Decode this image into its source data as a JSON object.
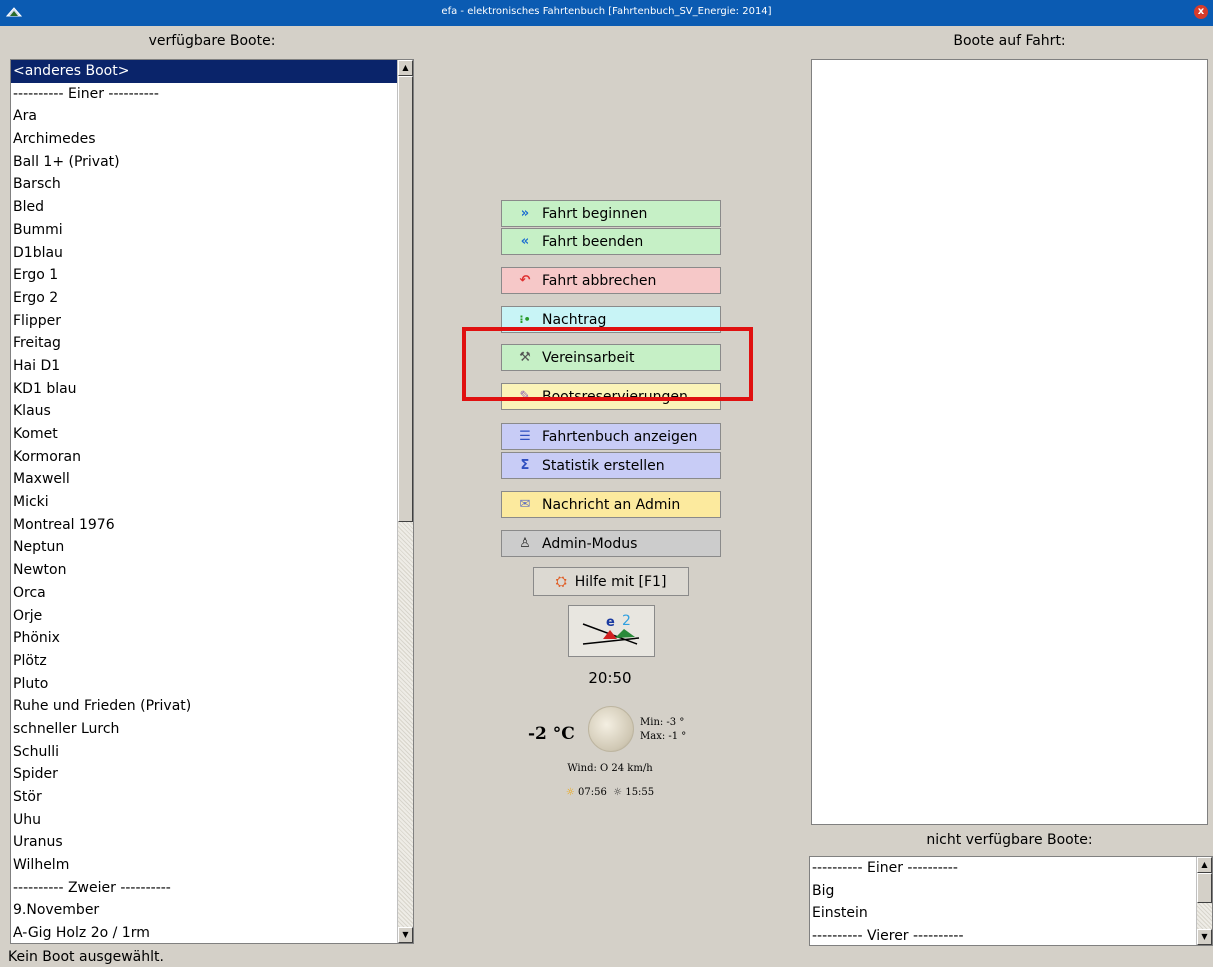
{
  "window": {
    "title": "efa - elektronisches Fahrtenbuch [Fahrtenbuch_SV_Energie: 2014]",
    "close_glyph": "x"
  },
  "available_boats": {
    "title": "verfügbare Boote:",
    "items": [
      "<anderes Boot>",
      "---------- Einer ----------",
      "Ara",
      "Archimedes",
      "Ball 1+ (Privat)",
      "Barsch",
      "Bled",
      "Bummi",
      "D1blau",
      "Ergo 1",
      "Ergo 2",
      "Flipper",
      "Freitag",
      "Hai D1",
      "KD1 blau",
      "Klaus",
      "Komet",
      "Kormoran",
      "Maxwell",
      "Micki",
      "Montreal 1976",
      "Neptun",
      "Newton",
      "Orca",
      "Orje",
      "Phönix",
      "Plötz",
      "Pluto",
      "Ruhe und Frieden (Privat)",
      "schneller Lurch",
      "Schulli",
      "Spider",
      "Stör",
      "Uhu",
      "Uranus",
      "Wilhelm",
      "---------- Zweier ----------",
      "9.November",
      "A-Gig Holz 2o / 1rm"
    ],
    "selected_index": 0
  },
  "boats_on_trip": {
    "title": "Boote auf Fahrt:",
    "items": []
  },
  "unavailable_boats": {
    "title": "nicht verfügbare Boote:",
    "items": [
      "---------- Einer ----------",
      "Big",
      "Einstein",
      "---------- Vierer ----------"
    ]
  },
  "actions": {
    "start_trip": "Fahrt beginnen",
    "end_trip": "Fahrt beenden",
    "cancel_trip": "Fahrt abbrechen",
    "late_entry": "Nachtrag",
    "club_work": "Vereinsarbeit",
    "boat_reservations": "Bootsreservierungen",
    "show_logbook": "Fahrtenbuch anzeigen",
    "create_statistics": "Statistik erstellen",
    "message_admin": "Nachricht an Admin",
    "admin_mode": "Admin-Modus",
    "help": "Hilfe mit [F1]"
  },
  "clock": "20:50",
  "weather": {
    "temperature": "-2 °C",
    "min": "Min: -3 °",
    "max": "Max: -1 °",
    "wind": "Wind: O 24 km/h",
    "sunrise": "07:56",
    "sunset": "15:55"
  },
  "status_text": "Kein Boot ausgewählt."
}
